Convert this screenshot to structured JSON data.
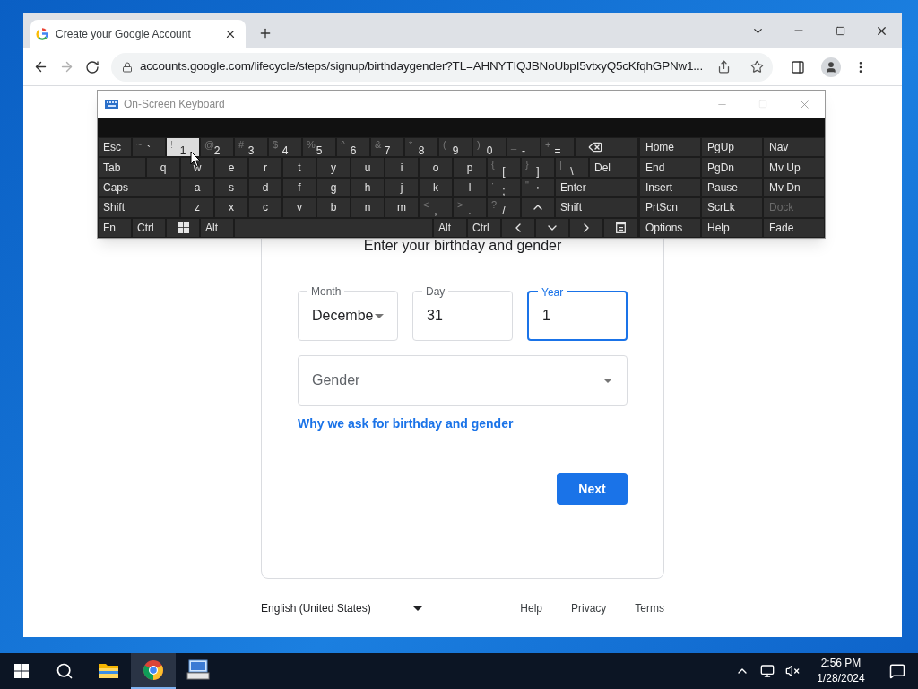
{
  "browser": {
    "tab": {
      "title": "Create your Google Account",
      "selected": true
    },
    "address": {
      "url": "accounts.google.com/lifecycle/steps/signup/birthdaygender?TL=AHNYTIQJBNoUbpI5vtxyQ5cKfqhGPNw1..."
    },
    "forward_disabled": true
  },
  "form": {
    "title": "Enter your birthday and gender",
    "fields": [
      {
        "label": "Month",
        "value": "Decembe",
        "kind": "select",
        "focused": false
      },
      {
        "label": "Day",
        "value": "31",
        "kind": "text",
        "focused": false
      },
      {
        "label": "Year",
        "value": "1",
        "kind": "text",
        "focused": true
      }
    ],
    "gender": {
      "placeholder": "Gender"
    },
    "link": "Why we ask for birthday and gender",
    "next": "Next"
  },
  "footer": {
    "language": "English (United States)",
    "links": [
      "Help",
      "Privacy",
      "Terms"
    ]
  },
  "keyboard": {
    "title": "On-Screen Keyboard",
    "rows": [
      {
        "keys": [
          {
            "kind": "key",
            "label": "Esc",
            "pressed": false
          },
          {
            "kind": "char",
            "label": "`",
            "secondary": "~",
            "pressed": false
          },
          {
            "kind": "char",
            "label": "1",
            "secondary": "!",
            "pressed": true
          },
          {
            "kind": "char",
            "label": "2",
            "secondary": "@",
            "pressed": false
          },
          {
            "kind": "char",
            "label": "3",
            "secondary": "#",
            "pressed": false
          },
          {
            "kind": "char",
            "label": "4",
            "secondary": "$",
            "pressed": false
          },
          {
            "kind": "char",
            "label": "5",
            "secondary": "%",
            "pressed": false
          },
          {
            "kind": "char",
            "label": "6",
            "secondary": "^",
            "pressed": false
          },
          {
            "kind": "char",
            "label": "7",
            "secondary": "&",
            "pressed": false
          },
          {
            "kind": "char",
            "label": "8",
            "secondary": "*",
            "pressed": false
          },
          {
            "kind": "char",
            "label": "9",
            "secondary": "(",
            "pressed": false
          },
          {
            "kind": "char",
            "label": "0",
            "secondary": ")",
            "pressed": false
          },
          {
            "kind": "char",
            "label": "-",
            "secondary": "_",
            "pressed": false
          },
          {
            "kind": "char",
            "label": "=",
            "secondary": "+",
            "pressed": false
          },
          {
            "kind": "backspace",
            "pressed": false
          }
        ]
      },
      {
        "keys": [
          {
            "kind": "wide",
            "label": "Tab",
            "pressed": false
          },
          {
            "kind": "char",
            "label": "q",
            "pressed": false
          },
          {
            "kind": "char",
            "label": "w",
            "pressed": false
          },
          {
            "kind": "char",
            "label": "e",
            "pressed": false
          },
          {
            "kind": "char",
            "label": "r",
            "pressed": false
          },
          {
            "kind": "char",
            "label": "t",
            "pressed": false
          },
          {
            "kind": "char",
            "label": "y",
            "pressed": false
          },
          {
            "kind": "char",
            "label": "u",
            "pressed": false
          },
          {
            "kind": "char",
            "label": "i",
            "pressed": false
          },
          {
            "kind": "char",
            "label": "o",
            "pressed": false
          },
          {
            "kind": "char",
            "label": "p",
            "pressed": false
          },
          {
            "kind": "char",
            "label": "[",
            "secondary": "{",
            "pressed": false
          },
          {
            "kind": "char",
            "label": "]",
            "secondary": "}",
            "pressed": false
          },
          {
            "kind": "char",
            "label": "\\",
            "secondary": "|",
            "pressed": false
          },
          {
            "kind": "wide",
            "label": "Del",
            "pressed": false
          }
        ]
      },
      {
        "keys": [
          {
            "kind": "wide",
            "label": "Caps",
            "pressed": false
          },
          {
            "kind": "char",
            "label": "a",
            "pressed": false
          },
          {
            "kind": "char",
            "label": "s",
            "pressed": false
          },
          {
            "kind": "char",
            "label": "d",
            "pressed": false
          },
          {
            "kind": "char",
            "label": "f",
            "pressed": false
          },
          {
            "kind": "char",
            "label": "g",
            "pressed": false
          },
          {
            "kind": "char",
            "label": "h",
            "pressed": false
          },
          {
            "kind": "char",
            "label": "j",
            "pressed": false
          },
          {
            "kind": "char",
            "label": "k",
            "pressed": false
          },
          {
            "kind": "char",
            "label": "l",
            "pressed": false
          },
          {
            "kind": "char",
            "label": ";",
            "secondary": ":",
            "pressed": false
          },
          {
            "kind": "char",
            "label": "'",
            "secondary": "\"",
            "pressed": false
          },
          {
            "kind": "wide",
            "label": "Enter",
            "pressed": false
          }
        ]
      },
      {
        "keys": [
          {
            "kind": "wide",
            "label": "Shift",
            "pressed": false
          },
          {
            "kind": "char",
            "label": "z",
            "pressed": false
          },
          {
            "kind": "char",
            "label": "x",
            "pressed": false
          },
          {
            "kind": "char",
            "label": "c",
            "pressed": false
          },
          {
            "kind": "char",
            "label": "v",
            "pressed": false
          },
          {
            "kind": "char",
            "label": "b",
            "pressed": false
          },
          {
            "kind": "char",
            "label": "n",
            "pressed": false
          },
          {
            "kind": "char",
            "label": "m",
            "pressed": false
          },
          {
            "kind": "char",
            "label": ",",
            "secondary": "<",
            "pressed": false
          },
          {
            "kind": "char",
            "label": ".",
            "secondary": ">",
            "pressed": false
          },
          {
            "kind": "char",
            "label": "/",
            "secondary": "?",
            "pressed": false
          },
          {
            "kind": "up",
            "pressed": false
          },
          {
            "kind": "wide",
            "label": "Shift",
            "pressed": false
          }
        ]
      },
      {
        "keys": [
          {
            "kind": "key",
            "label": "Fn",
            "pressed": false
          },
          {
            "kind": "key",
            "label": "Ctrl",
            "pressed": false
          },
          {
            "kind": "windows",
            "pressed": false
          },
          {
            "kind": "key",
            "label": "Alt",
            "pressed": false
          },
          {
            "kind": "space",
            "pressed": false
          },
          {
            "kind": "key",
            "label": "Alt",
            "pressed": false
          },
          {
            "kind": "key",
            "label": "Ctrl",
            "pressed": false
          },
          {
            "kind": "left",
            "pressed": false
          },
          {
            "kind": "down",
            "pressed": false
          },
          {
            "kind": "right",
            "pressed": false
          },
          {
            "kind": "menu",
            "pressed": false
          }
        ]
      }
    ],
    "nav": [
      [
        {
          "label": "Home",
          "disabled": false
        },
        {
          "label": "PgUp",
          "disabled": false
        },
        {
          "label": "Nav",
          "disabled": false
        }
      ],
      [
        {
          "label": "End",
          "disabled": false
        },
        {
          "label": "PgDn",
          "disabled": false
        },
        {
          "label": "Mv Up",
          "disabled": false
        }
      ],
      [
        {
          "label": "Insert",
          "disabled": false
        },
        {
          "label": "Pause",
          "disabled": false
        },
        {
          "label": "Mv Dn",
          "disabled": false
        }
      ],
      [
        {
          "label": "PrtScn",
          "disabled": false
        },
        {
          "label": "ScrLk",
          "disabled": false
        },
        {
          "label": "Dock",
          "disabled": true
        }
      ],
      [
        {
          "label": "Options",
          "disabled": false
        },
        {
          "label": "Help",
          "disabled": false
        },
        {
          "label": "Fade",
          "disabled": false
        }
      ]
    ]
  },
  "taskbar": {
    "apps": [
      {
        "kind": "explorer",
        "selected": false
      },
      {
        "kind": "chrome",
        "selected": true
      },
      {
        "kind": "keyboard",
        "selected": false
      }
    ],
    "time": "2:56 PM",
    "date": "1/28/2024"
  }
}
